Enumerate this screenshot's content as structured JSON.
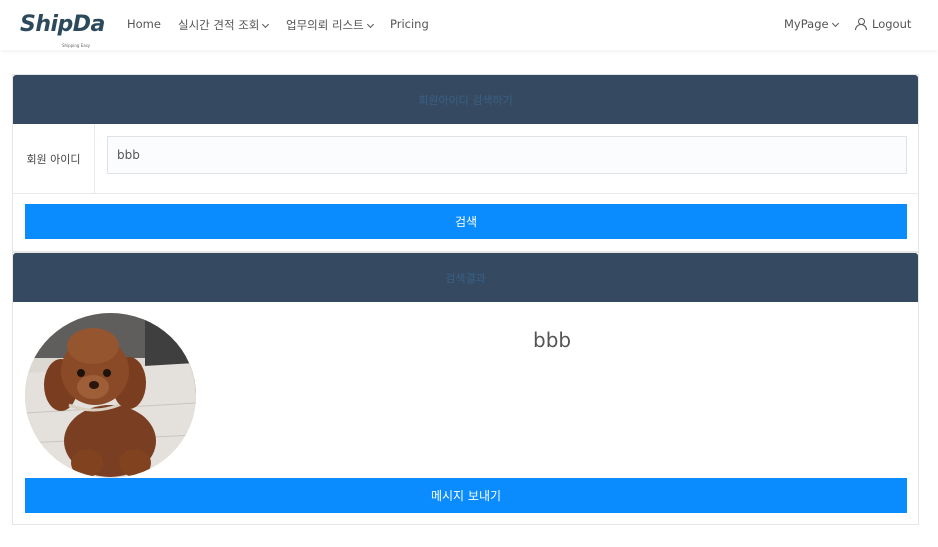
{
  "brand": {
    "logo_text": "ShipDa",
    "logo_sub": "Shipping Easy",
    "color": "#2d4a5c"
  },
  "nav": {
    "left": [
      {
        "label": "Home",
        "dropdown": false
      },
      {
        "label": "실시간 견적 조회",
        "dropdown": true
      },
      {
        "label": "업무의뢰 리스트",
        "dropdown": true
      },
      {
        "label": "Pricing",
        "dropdown": false
      }
    ],
    "mypage": "MyPage",
    "logout": "Logout"
  },
  "search_panel": {
    "title": "회원아이디 검색하기",
    "field_label": "회원 아이디",
    "field_value": "bbb",
    "search_button": "검색"
  },
  "result_panel": {
    "title": "검색결과",
    "username": "bbb",
    "message_button": "메시지 보내기"
  },
  "colors": {
    "header_bg": "#354a60",
    "accent": "#0a8cff"
  },
  "icons": {
    "user": "user-icon",
    "dropdown": "chevron-down-icon"
  }
}
